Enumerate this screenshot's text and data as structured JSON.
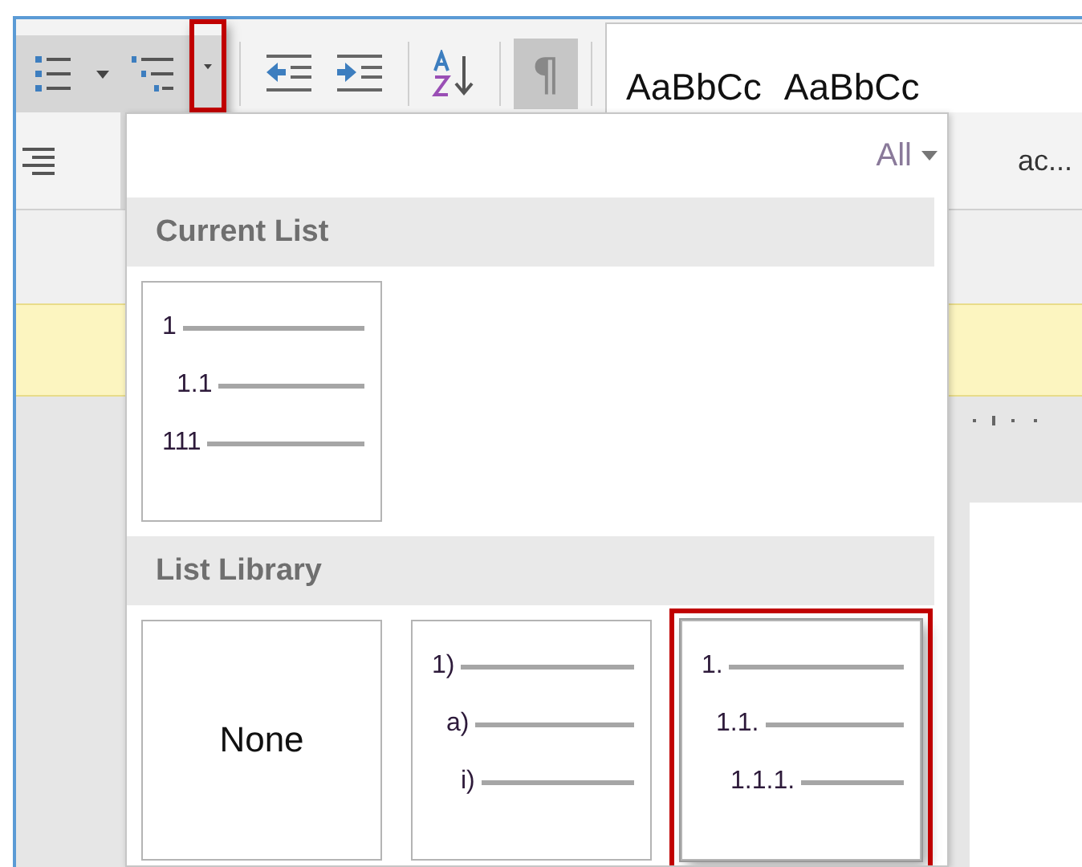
{
  "toolbar": {
    "multilevel_list": {
      "expanded": true
    },
    "show_marks": {
      "glyph": "¶",
      "on": true
    }
  },
  "styles_gallery": {
    "samples": [
      "AaBbCc",
      "AaBbCc"
    ],
    "style_name": "ac..."
  },
  "list_menu": {
    "filter": "All",
    "sections": [
      {
        "title": "Current List",
        "items": [
          {
            "kind": "levels",
            "selected": false,
            "levels": [
              {
                "label": "1",
                "children": [
                  {
                    "label": "1.1"
                  }
                ]
              },
              {
                "label": "111"
              }
            ]
          }
        ]
      },
      {
        "title": "List Library",
        "items": [
          {
            "kind": "none",
            "label": "None",
            "selected": false
          },
          {
            "kind": "levels",
            "selected": false,
            "levels": [
              {
                "label": "1)",
                "children": [
                  {
                    "label": "a)",
                    "children": [
                      {
                        "label": "i)"
                      }
                    ]
                  }
                ]
              }
            ]
          },
          {
            "kind": "levels",
            "selected": true,
            "levels": [
              {
                "label": "1.",
                "children": [
                  {
                    "label": "1.1.",
                    "children": [
                      {
                        "label": "1.1.1."
                      }
                    ]
                  }
                ]
              }
            ]
          }
        ]
      }
    ]
  }
}
